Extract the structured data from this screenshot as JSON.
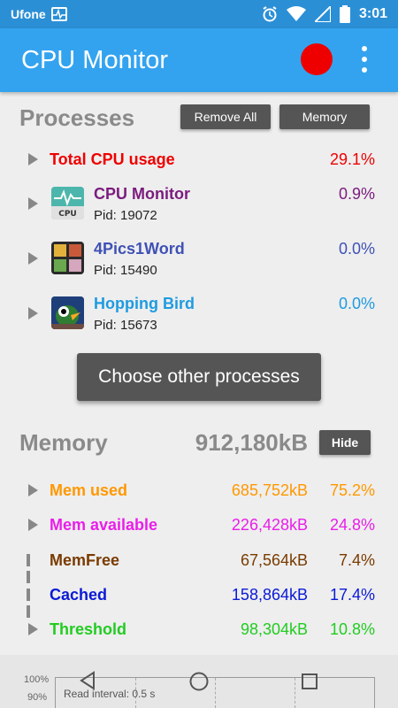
{
  "status_bar": {
    "carrier": "Ufone",
    "time": "3:01",
    "icons": [
      "pulse-icon",
      "alarm-icon",
      "wifi-icon",
      "signal-icon",
      "battery-icon"
    ]
  },
  "app_bar": {
    "title": "CPU Monitor",
    "record_color": "#ee0000"
  },
  "processes": {
    "title": "Processes",
    "remove_all_label": "Remove All",
    "memory_label": "Memory",
    "total": {
      "label": "Total CPU usage",
      "value": "29.1%",
      "color": "#ee0000"
    },
    "items": [
      {
        "name": "CPU Monitor",
        "pid": "Pid: 19072",
        "value": "0.9%",
        "color": "#7b1b7e",
        "icon": "cpu-monitor-app-icon"
      },
      {
        "name": "4Pics1Word",
        "pid": "Pid: 15490",
        "value": "0.0%",
        "color": "#3f51b5",
        "icon": "4pics1word-app-icon"
      },
      {
        "name": "Hopping Bird",
        "pid": "Pid: 15673",
        "value": "0.0%",
        "color": "#1e9be0",
        "icon": "hopping-bird-app-icon"
      }
    ],
    "choose_label": "Choose other processes"
  },
  "memory": {
    "title": "Memory",
    "total": "912,180kB",
    "hide_label": "Hide",
    "rows": [
      {
        "label": "Mem used",
        "kb": "685,752kB",
        "pct": "75.2%",
        "color": "#ff9800",
        "control": "play"
      },
      {
        "label": "Mem available",
        "kb": "226,428kB",
        "pct": "24.8%",
        "color": "#e91ee9",
        "control": "play"
      },
      {
        "label": "MemFree",
        "kb": "67,564kB",
        "pct": "7.4%",
        "color": "#7a3b00",
        "control": "pause"
      },
      {
        "label": "Cached",
        "kb": "158,864kB",
        "pct": "17.4%",
        "color": "#0a1ad6",
        "control": "pause"
      },
      {
        "label": "Threshold",
        "kb": "98,304kB",
        "pct": "10.8%",
        "color": "#22cc22",
        "control": "play"
      }
    ]
  },
  "graph": {
    "ticks": [
      "100%",
      "90%"
    ],
    "read_interval": "Read interval: 0.5 s"
  },
  "nav": [
    "back-icon",
    "home-icon",
    "recents-icon"
  ]
}
